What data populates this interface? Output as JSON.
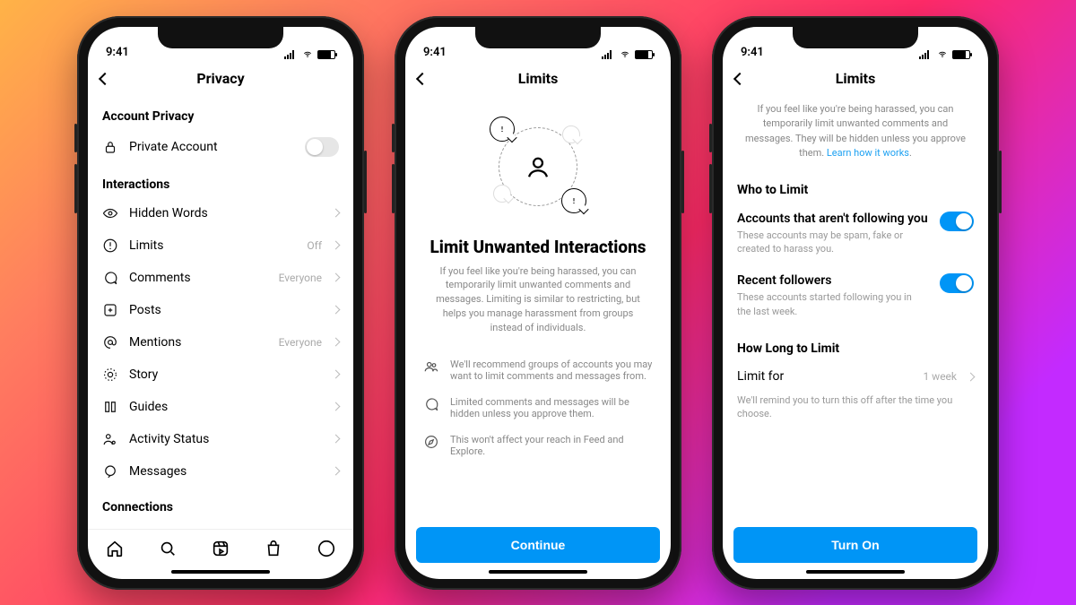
{
  "status": {
    "time": "9:41"
  },
  "screen1": {
    "title": "Privacy",
    "section_account": "Account Privacy",
    "private_account": "Private Account",
    "section_interactions": "Interactions",
    "items": {
      "hidden_words": {
        "label": "Hidden Words",
        "value": ""
      },
      "limits": {
        "label": "Limits",
        "value": "Off"
      },
      "comments": {
        "label": "Comments",
        "value": "Everyone"
      },
      "posts": {
        "label": "Posts",
        "value": ""
      },
      "mentions": {
        "label": "Mentions",
        "value": "Everyone"
      },
      "story": {
        "label": "Story",
        "value": ""
      },
      "guides": {
        "label": "Guides",
        "value": ""
      },
      "activity": {
        "label": "Activity Status",
        "value": ""
      },
      "messages": {
        "label": "Messages",
        "value": ""
      }
    },
    "section_connections": "Connections"
  },
  "screen2": {
    "title": "Limits",
    "headline": "Limit Unwanted Interactions",
    "paragraph": "If you feel like you're being harassed, you can temporarily limit unwanted comments and messages. Limiting is similar to restricting, but helps you manage harassment from groups instead of individuals.",
    "bullets": {
      "b1": "We'll recommend groups of accounts you may want to limit comments and messages from.",
      "b2": "Limited comments and messages will be hidden unless you approve them.",
      "b3": "This won't affect your reach in Feed and Explore."
    },
    "cta": "Continue"
  },
  "screen3": {
    "title": "Limits",
    "intro": "If you feel like you're being harassed, you can temporarily limit unwanted comments and messages. They will be hidden unless you approve them. ",
    "intro_link": "Learn how it works",
    "section_who": "Who to Limit",
    "opt1_title": "Accounts that aren't following you",
    "opt1_desc": "These accounts may be spam, fake or created to harass you.",
    "opt2_title": "Recent followers",
    "opt2_desc": "These accounts started following you in the last week.",
    "section_how": "How Long to Limit",
    "limit_for_label": "Limit for",
    "limit_for_value": "1 week",
    "reminder": "We'll remind you to turn this off after the time you choose.",
    "cta": "Turn On"
  }
}
